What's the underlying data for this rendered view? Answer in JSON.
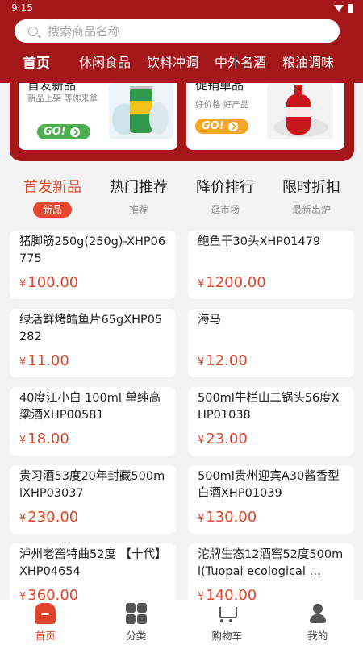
{
  "status": {
    "time": "9:15"
  },
  "search": {
    "placeholder": "搜索商品名称"
  },
  "nav": {
    "tabs": [
      "首页",
      "休闲食品",
      "饮料冲调",
      "中外名酒",
      "粮油调味"
    ]
  },
  "promo": [
    {
      "title": "首发新品",
      "sub": "新品上架 等你来拿",
      "go": "GO!"
    },
    {
      "title": "促销单品",
      "sub": "好价格 好产品",
      "go": "GO!"
    }
  ],
  "categories": [
    {
      "title": "首发新品",
      "sub": "新品"
    },
    {
      "title": "热门推荐",
      "sub": "推荐"
    },
    {
      "title": "降价排行",
      "sub": "逛市场"
    },
    {
      "title": "限时折扣",
      "sub": "最新出炉"
    }
  ],
  "currency": "¥",
  "products": [
    {
      "name": "猪脚筋250g(250g)-XHP06775",
      "price": "100.00"
    },
    {
      "name": "鲍鱼干30头XHP01479",
      "price": "1200.00"
    },
    {
      "name": "绿活鲜烤鳕鱼片65gXHP05282",
      "price": "11.00"
    },
    {
      "name": "海马",
      "price": "12.00"
    },
    {
      "name": "40度江小白  100ml 单纯高粱酒XHP00581",
      "price": "18.00"
    },
    {
      "name": "500ml牛栏山二锅头56度XHP01038",
      "price": "23.00"
    },
    {
      "name": "贵习酒53度20年封藏500mlXHP03037",
      "price": "230.00"
    },
    {
      "name": "500ml贵州迎宾A30酱香型白酒XHP01039",
      "price": "130.00"
    },
    {
      "name": "泸州老窖特曲52度 【十代】XHP04654",
      "price": "360.00"
    },
    {
      "name": "沱牌生态12酒窖52度500ml(Tuopai ecological …",
      "price": "140.00"
    }
  ],
  "tabbar": [
    {
      "label": "首页",
      "icon": "home-icon"
    },
    {
      "label": "分类",
      "icon": "grid-icon"
    },
    {
      "label": "购物车",
      "icon": "cart-icon"
    },
    {
      "label": "我的",
      "icon": "user-icon"
    }
  ],
  "colors": {
    "brand": "#a3161a",
    "accent": "#e0452b",
    "go_green": "#4caf50",
    "go_orange": "#f5a623"
  }
}
